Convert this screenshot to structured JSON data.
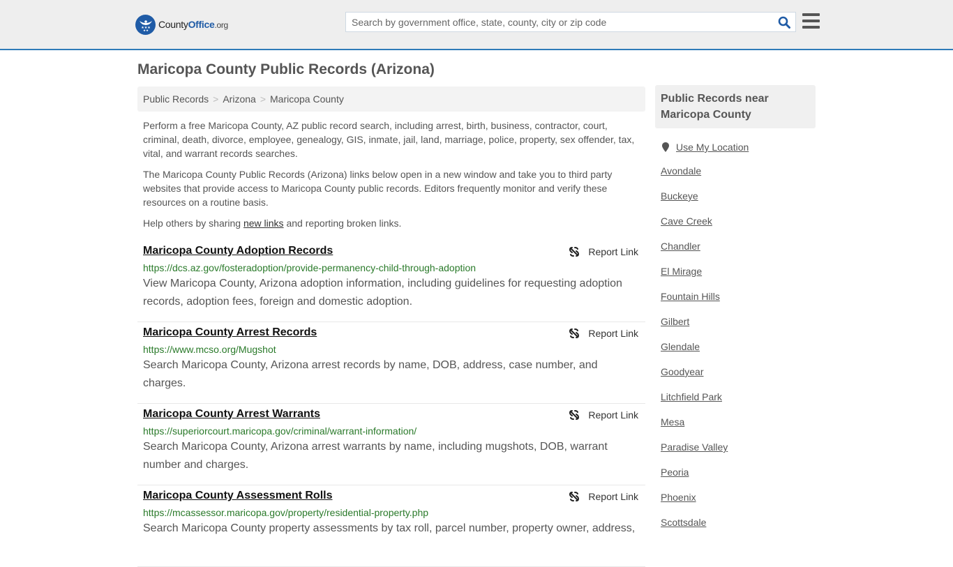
{
  "header": {
    "logo": {
      "part1": "County",
      "part2": "Office",
      "part3": ".org"
    },
    "search": {
      "placeholder": "Search by government office, state, county, city or zip code",
      "value": ""
    },
    "icons": {
      "search": "search-icon",
      "menu": "hamburger-menu-icon"
    }
  },
  "page": {
    "title": "Maricopa County Public Records (Arizona)"
  },
  "breadcrumb": [
    {
      "label": "Public Records"
    },
    {
      "label": "Arizona"
    },
    {
      "label": "Maricopa County"
    }
  ],
  "breadcrumb_separator": ">",
  "intro": {
    "p1": "Perform a free Maricopa County, AZ public record search, including arrest, birth, business, contractor, court, criminal, death, divorce, employee, genealogy, GIS, inmate, jail, land, marriage, police, property, sex offender, tax, vital, and warrant records searches.",
    "p2": "The Maricopa County Public Records (Arizona) links below open in a new window and take you to third party websites that provide access to Maricopa County public records. Editors frequently monitor and verify these resources on a routine basis.",
    "p3_before": "Help others by sharing ",
    "p3_link": "new links",
    "p3_after": " and reporting broken links."
  },
  "report_label": "Report Link",
  "records": [
    {
      "title": "Maricopa County Adoption Records",
      "url": "https://dcs.az.gov/fosteradoption/provide-permanency-child-through-adoption",
      "description": "View Maricopa County, Arizona adoption information, including guidelines for requesting adoption records, adoption fees, foreign and domestic adoption."
    },
    {
      "title": "Maricopa County Arrest Records",
      "url": "https://www.mcso.org/Mugshot",
      "description": "Search Maricopa County, Arizona arrest records by name, DOB, address, case number, and charges."
    },
    {
      "title": "Maricopa County Arrest Warrants",
      "url": "https://superiorcourt.maricopa.gov/criminal/warrant-information/",
      "description": "Search Maricopa County, Arizona arrest warrants by name, including mugshots, DOB, warrant number and charges."
    },
    {
      "title": "Maricopa County Assessment Rolls",
      "url": "https://mcassessor.maricopa.gov/property/residential-property.php",
      "description": "Search Maricopa County property assessments by tax roll, parcel number, property owner, address,"
    }
  ],
  "sidebar": {
    "heading": "Public Records near Maricopa County",
    "use_location": "Use My Location",
    "cities": [
      "Avondale",
      "Buckeye",
      "Cave Creek",
      "Chandler",
      "El Mirage",
      "Fountain Hills",
      "Gilbert",
      "Glendale",
      "Goodyear",
      "Litchfield Park",
      "Mesa",
      "Paradise Valley",
      "Peoria",
      "Phoenix",
      "Scottsdale"
    ]
  },
  "colors": {
    "brand_blue": "#1f5ba6",
    "header_border": "#2e7bb8",
    "url_green": "#2a7a2a"
  }
}
